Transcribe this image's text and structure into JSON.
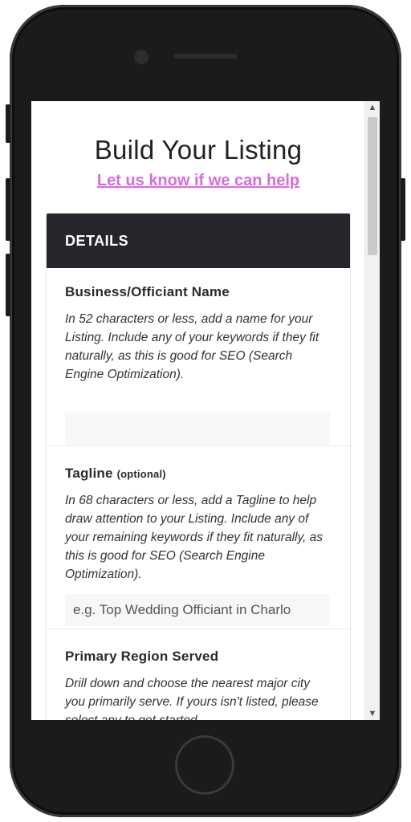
{
  "page": {
    "title": "Build Your Listing",
    "help_link": "Let us know if we can help"
  },
  "card": {
    "header": "DETAILS",
    "sections": [
      {
        "title": "Business/Officiant Name",
        "optional": "",
        "description": "In 52 characters or less, add a name for your Listing. Include any of your keywords if they fit naturally, as this is good for SEO (Search Engine Optimization).",
        "placeholder": ""
      },
      {
        "title": "Tagline",
        "optional": "(optional)",
        "description": "In 68 characters or less, add a Tagline to help draw attention to your Listing. Include any of your remaining keywords if they fit naturally, as this is good for SEO (Search Engine Optimization).",
        "placeholder": "e.g. Top Wedding Officiant in Charlo"
      },
      {
        "title": "Primary Region Served",
        "optional": "",
        "description": "Drill down and choose the nearest major city you primarily serve. If yours isn't listed, please select any to get started.",
        "placeholder": ""
      }
    ]
  },
  "colors": {
    "accent": "#d86bdc",
    "header_bg": "#25252b",
    "phone_body": "#1b1b1d"
  },
  "icons": {
    "scroll_up": "▲",
    "scroll_down": "▼"
  }
}
